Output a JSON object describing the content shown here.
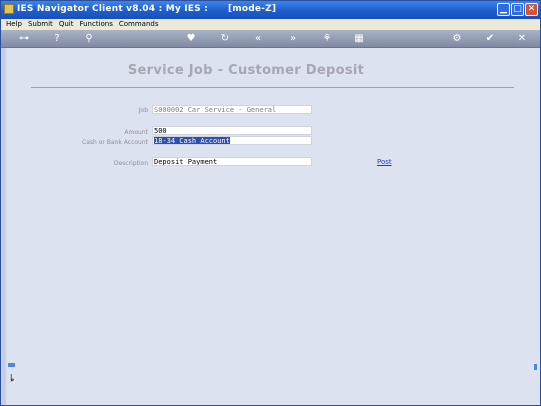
{
  "window": {
    "title": "IES Navigator Client v8.04 : My IES :      [mode-Z]"
  },
  "menu": [
    "Help",
    "Submit",
    "Quit",
    "Functions",
    "Commands"
  ],
  "toolbar": {
    "key": "⊶",
    "help": "?",
    "search": "⚲",
    "heart": "♥",
    "refresh": "↻",
    "back": "«",
    "forward": "»",
    "tree": "⚘",
    "grid": "▦",
    "gear": "⚙",
    "ok": "✔",
    "close": "✕"
  },
  "form": {
    "title": "Service Job - Customer Deposit",
    "job_label": "Job",
    "job_value": "S000002 Car Service - General",
    "amount_label": "Amount",
    "amount_value": "500",
    "account_label": "Cash or Bank Account",
    "account_value": "18-34 Cash Account",
    "description_label": "Description",
    "description_value": "Deposit Payment",
    "post_label": "Post"
  },
  "side": {
    "glyph": "ȴ"
  }
}
